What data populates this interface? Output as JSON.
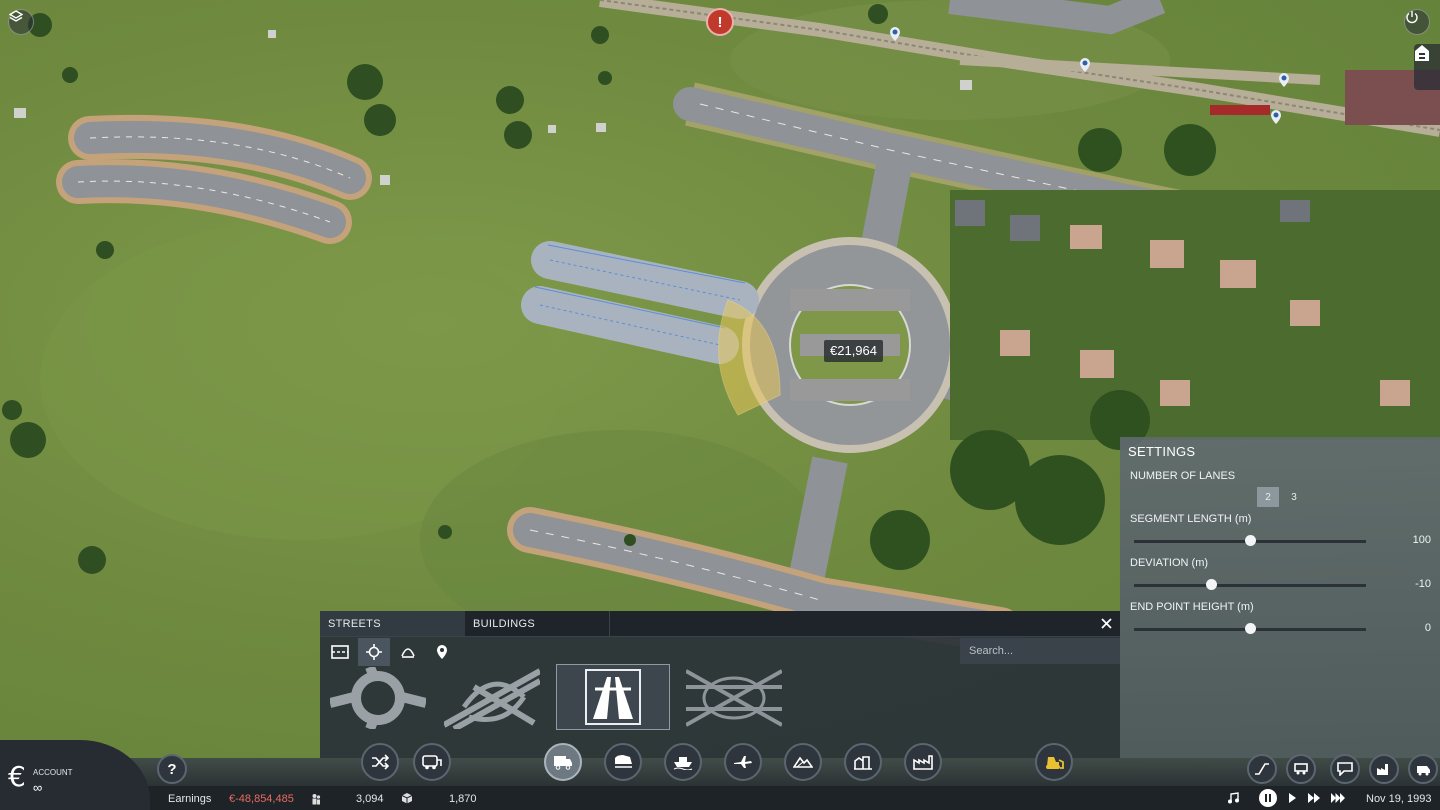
{
  "map": {
    "construction_cost": "€21,964"
  },
  "build_panel": {
    "tabs": [
      {
        "label": "STREETS",
        "active": true
      },
      {
        "label": "BUILDINGS",
        "active": false
      }
    ],
    "subtools": [
      "street-icon",
      "crossing-icon",
      "bridge-icon",
      "pin-icon"
    ],
    "active_subtool": 1,
    "search": {
      "placeholder": "Search...",
      "value": ""
    },
    "items": [
      "roundabout",
      "cloverleaf-interchange",
      "highway-ramp",
      "highway-interchange"
    ],
    "active_item": 2
  },
  "settings": {
    "title": "SETTINGS",
    "number_of_lanes": {
      "label": "NUMBER OF LANES",
      "options": [
        "2",
        "3"
      ],
      "selected": "2"
    },
    "segment_length": {
      "label": "SEGMENT LENGTH (m)",
      "value": "100",
      "fraction": 0.5
    },
    "deviation": {
      "label": "DEVIATION (m)",
      "value": "-10",
      "fraction": 0.33
    },
    "end_point_height": {
      "label": "END POINT HEIGHT (m)",
      "value": "0",
      "fraction": 0.5
    }
  },
  "account": {
    "label": "ACCOUNT",
    "value": "∞",
    "currency_symbol": "€"
  },
  "status": {
    "earnings_label": "Earnings",
    "earnings_value": "€-48,854,485",
    "population": "3,094",
    "cargo": "1,870",
    "date": "Nov 19, 1993"
  },
  "toolbar": {
    "help": "?",
    "center_buttons": [
      "lines-icon",
      "vehicles-icon",
      "road-vehicle-icon",
      "train-icon",
      "ship-icon",
      "plane-icon",
      "terrain-icon",
      "city-icon",
      "industry-icon",
      "bulldozer-icon"
    ],
    "active_center": 2,
    "right_buttons": [
      "track-icon",
      "road-station-icon",
      "speech-icon",
      "factory-icon",
      "train-depot-icon"
    ]
  },
  "colors": {
    "grass": "#6f8a3f",
    "road": "#8c8f93",
    "selection": "#e8c75a",
    "ghost": "#5b8ed6",
    "earnings_negative": "#e86b5f"
  }
}
